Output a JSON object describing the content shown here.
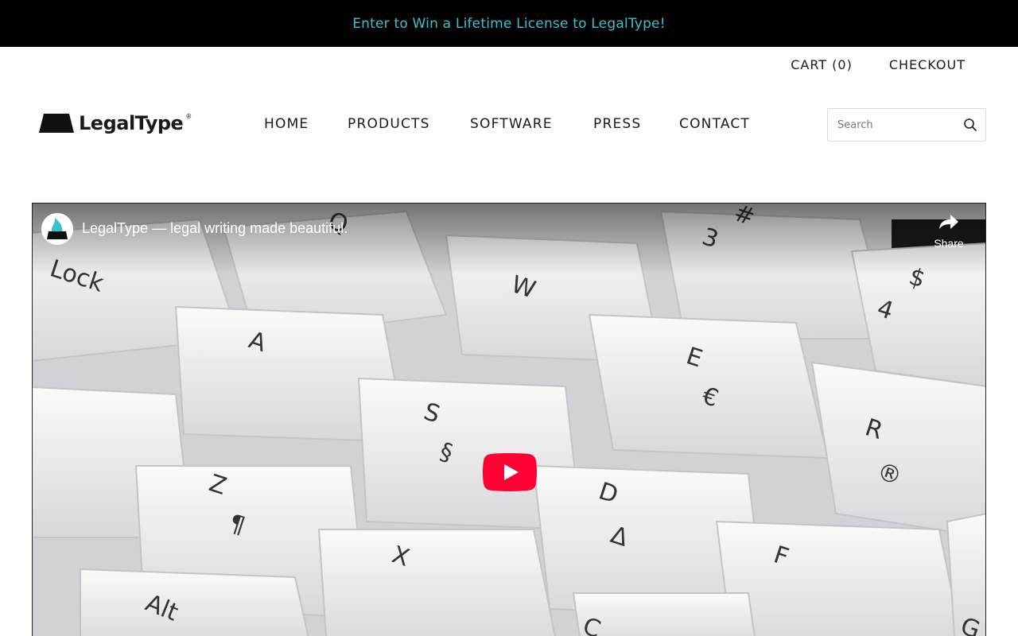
{
  "announcement": {
    "text": "Enter to Win a Lifetime License to LegalType!"
  },
  "utility": {
    "cart": "CART (0)",
    "checkout": "CHECKOUT"
  },
  "brand": {
    "name": "LegalType",
    "registered": "®"
  },
  "nav": {
    "items": [
      "HOME",
      "PRODUCTS",
      "SOFTWARE",
      "PRESS",
      "CONTACT"
    ]
  },
  "search": {
    "placeholder": "Search"
  },
  "video": {
    "title": "LegalType — legal writing made beautiful.",
    "share_label": "Share",
    "key_legends": [
      "Lock",
      "A",
      "W",
      "3",
      "#",
      "$",
      "4",
      "E",
      "€",
      "S",
      "§",
      "R",
      "®",
      "Z",
      "¶",
      "D",
      "Δ",
      "X",
      "F",
      "Alt",
      "C",
      "G",
      "Q"
    ]
  },
  "colors": {
    "announce_bg": "#000000",
    "announce_text": "#3cc1cb",
    "play_red": "#ff0033"
  }
}
